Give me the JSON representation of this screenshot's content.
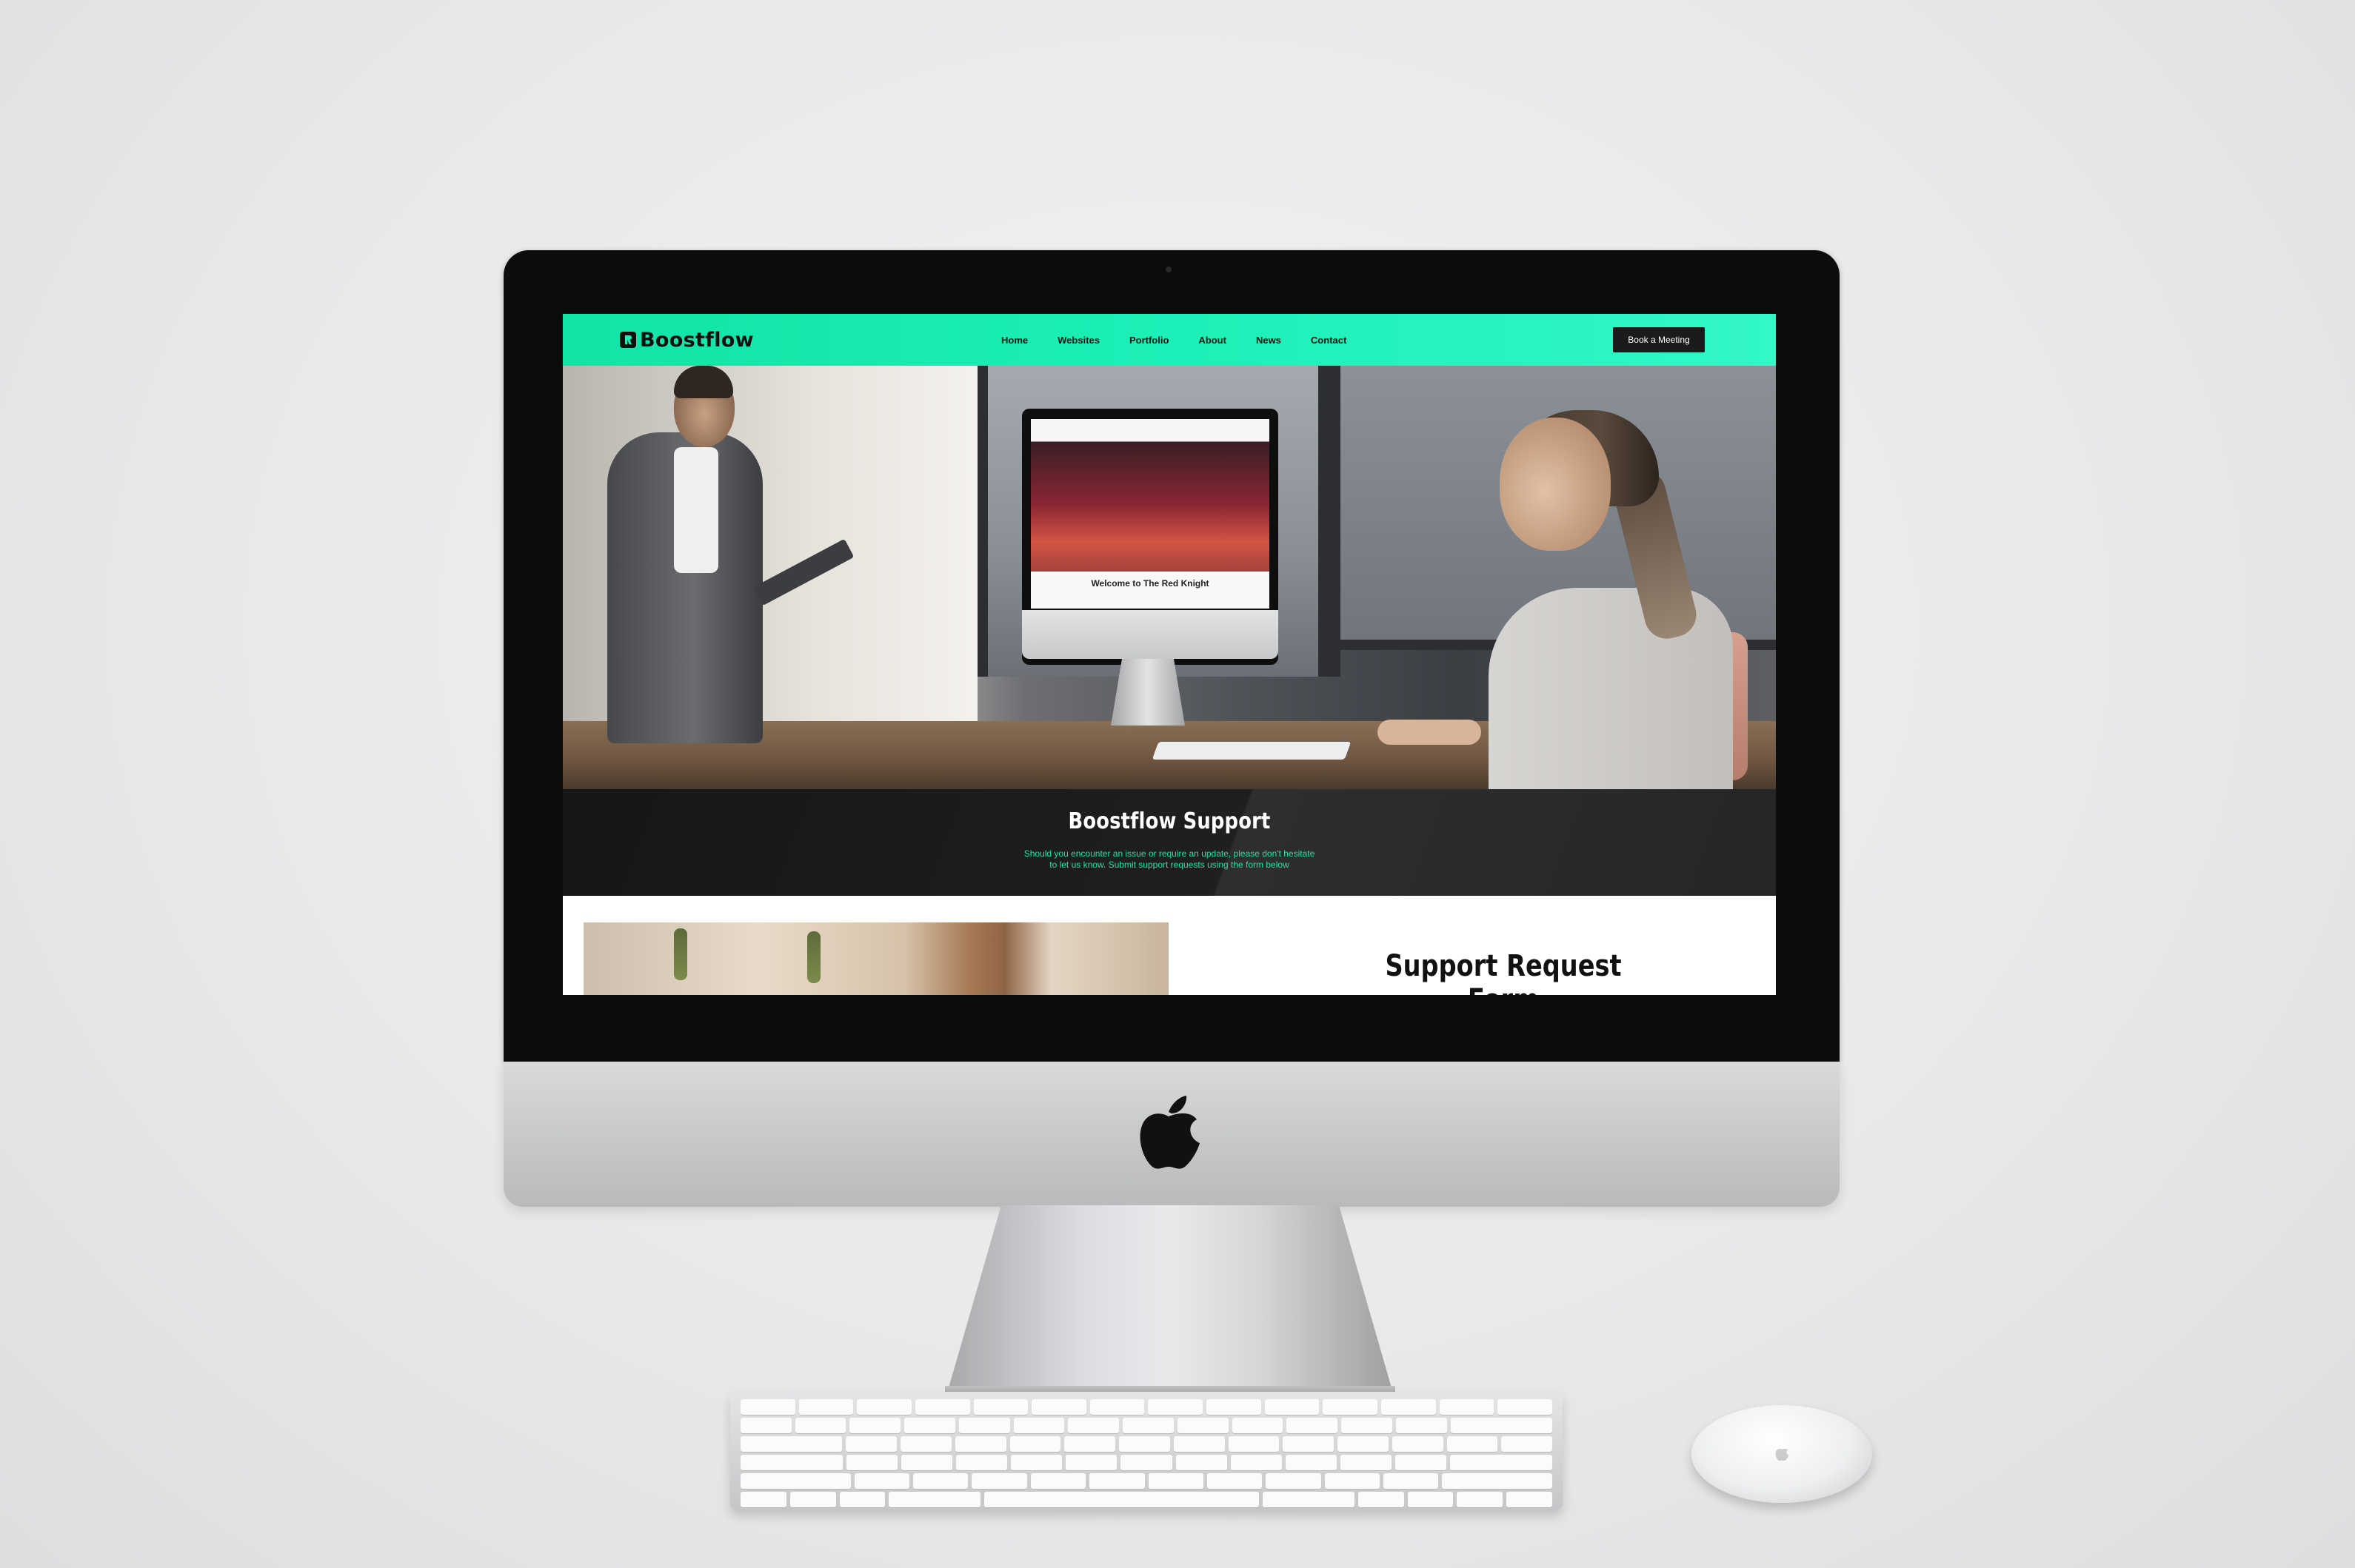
{
  "site": {
    "brand": "Boostflow",
    "accent_color": "#1cefb7",
    "dark_color": "#1b1b1b"
  },
  "nav": {
    "items": [
      {
        "label": "Home"
      },
      {
        "label": "Websites"
      },
      {
        "label": "Portfolio"
      },
      {
        "label": "About"
      },
      {
        "label": "News"
      },
      {
        "label": "Contact"
      }
    ],
    "cta_label": "Book a Meeting"
  },
  "hero": {
    "inner_screen_caption": "Welcome to The Red Knight"
  },
  "banner": {
    "title": "Boostflow Support",
    "subtitle_line1": "Should you encounter an issue or require an update, please don't hesitate",
    "subtitle_line2": "to let us know. Submit support requests using the form below"
  },
  "form_section": {
    "title": "Support Request Form"
  },
  "icons": {
    "brand": "boostflow-logo-icon",
    "computer": "apple-logo-icon"
  }
}
